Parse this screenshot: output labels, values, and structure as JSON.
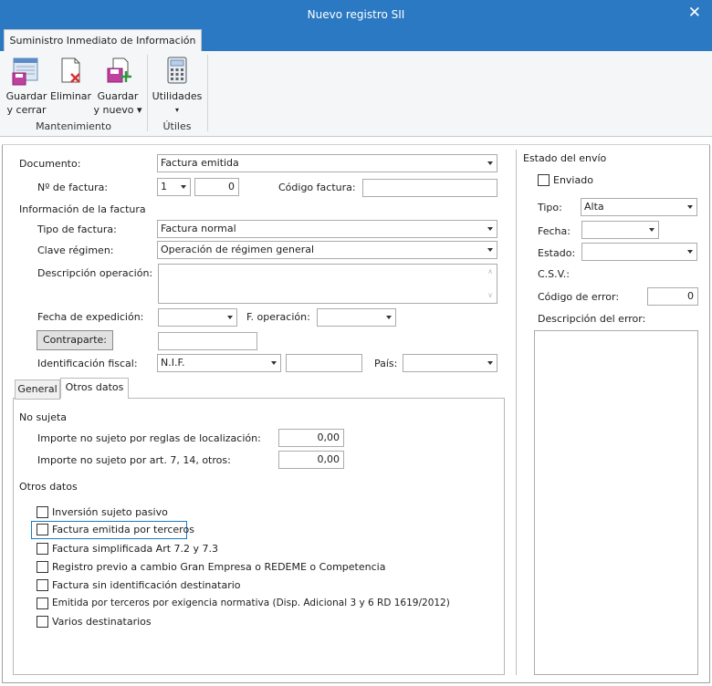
{
  "window": {
    "title": "Nuevo registro SII",
    "close_glyph": "✕"
  },
  "ribbon": {
    "tab_label": "Suministro Inmediato de Información",
    "buttons": {
      "save_close": {
        "line1": "Guardar",
        "line2": "y cerrar"
      },
      "delete": {
        "line1": "Eliminar"
      },
      "save_new": {
        "line1": "Guardar",
        "line2": "y nuevo ▾"
      },
      "utilities": {
        "line1": "Utilidades",
        "line2": "▾"
      }
    },
    "groups": {
      "maintenance": "Mantenimiento",
      "useful": "Útiles"
    }
  },
  "form": {
    "documento": {
      "label": "Documento:",
      "value": "Factura emitida"
    },
    "num_factura": {
      "label": "Nº de factura:",
      "series": "1",
      "number": "0"
    },
    "codigo_factura": {
      "label": "Código factura:",
      "value": ""
    },
    "info_section": "Información de la factura",
    "tipo_factura": {
      "label": "Tipo de factura:",
      "value": "Factura normal"
    },
    "clave_regimen": {
      "label": "Clave régimen:",
      "value": "Operación de régimen general"
    },
    "descripcion": {
      "label": "Descripción operación:",
      "value": ""
    },
    "fecha_expedicion": {
      "label": "Fecha de expedición:",
      "value": ""
    },
    "f_operacion": {
      "label": "F. operación:",
      "value": ""
    },
    "contraparte": {
      "button": "Contraparte:",
      "value": ""
    },
    "identificacion": {
      "label": "Identificación fiscal:",
      "type": "N.I.F.",
      "value": ""
    },
    "pais": {
      "label": "País:",
      "value": ""
    }
  },
  "tabs": [
    {
      "label": "General"
    },
    {
      "label": "Otros datos"
    }
  ],
  "otros": {
    "no_sujeta_title": "No sujeta",
    "importe_localizacion": {
      "label": "Importe no sujeto por reglas de localización:",
      "value": "0,00"
    },
    "importe_art": {
      "label": "Importe no sujeto por art. 7, 14, otros:",
      "value": "0,00"
    },
    "otros_title": "Otros datos",
    "checkboxes": [
      {
        "label": "Inversión sujeto pasivo",
        "checked": false
      },
      {
        "label": "Factura emitida por terceros",
        "checked": false
      },
      {
        "label": "Factura simplificada Art 7.2 y 7.3",
        "checked": false
      },
      {
        "label": "Registro previo a cambio Gran Empresa o REDEME o Competencia",
        "checked": false
      },
      {
        "label": "Factura sin identificación destinatario",
        "checked": false
      },
      {
        "label": "Emitida por terceros por exigencia normativa (Disp. Adicional 3 y 6 RD 1619/2012)",
        "checked": false
      },
      {
        "label": "Varios destinatarios",
        "checked": false
      }
    ]
  },
  "estado": {
    "title": "Estado del envío",
    "enviado": {
      "label": "Enviado",
      "checked": false
    },
    "tipo": {
      "label": "Tipo:",
      "value": "Alta"
    },
    "fecha": {
      "label": "Fecha:",
      "value": ""
    },
    "estado": {
      "label": "Estado:",
      "value": ""
    },
    "csv": {
      "label": "C.S.V.:"
    },
    "codigo_error": {
      "label": "Código de error:",
      "value": "0"
    },
    "descripcion_error": {
      "label": "Descripción del error:",
      "value": ""
    }
  },
  "colors": {
    "titlebar": "#2b79c2",
    "focus": "#1a7bc4"
  }
}
